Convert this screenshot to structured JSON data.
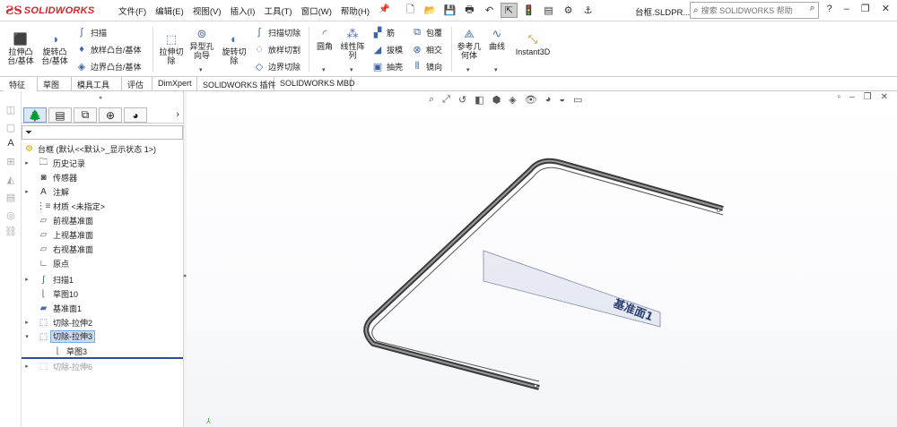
{
  "app": {
    "logo_text": "SOLIDWORKS",
    "document_title": "台框.SLDPR...",
    "search_placeholder": "搜索 SOLIDWORKS 帮助"
  },
  "menu": [
    "文件(F)",
    "编辑(E)",
    "视图(V)",
    "插入(I)",
    "工具(T)",
    "窗口(W)",
    "帮助(H)"
  ],
  "ribbon": {
    "extrude_boss": "拉伸凸\n台/基体",
    "revolve_boss": "旋转凸\n台/基体",
    "sweep": "扫描",
    "loft_boss": "放样凸台/基体",
    "boundary_boss": "边界凸台/基体",
    "extrude_cut": "拉伸切\n除",
    "hole_wizard": "异型孔\n向导",
    "revolve_cut": "旋转切\n除",
    "sweep_cut": "扫描切除",
    "loft_cut": "放样切割",
    "boundary_cut": "边界切除",
    "fillet": "圆角",
    "linear_pattern": "线性阵\n列",
    "rib": "筋",
    "draft": "拔模",
    "shell": "抽壳",
    "wrap": "包覆",
    "intersect": "相交",
    "mirror": "镜向",
    "reference_geometry": "参考几\n何体",
    "curves": "曲线",
    "instant3d": "Instant3D"
  },
  "tabs": [
    "特征",
    "草图",
    "模具工具",
    "评估",
    "DimXpert",
    "SOLIDWORKS 插件",
    "SOLIDWORKS MBD"
  ],
  "tree": {
    "root": "台框 (默认<<默认>_显示状态 1>)",
    "history": "历史记录",
    "sensors": "传感器",
    "annotations": "注解",
    "material": "材质 <未指定>",
    "front_plane": "前视基准面",
    "top_plane": "上视基准面",
    "right_plane": "右视基准面",
    "origin": "原点",
    "sweep1": "扫描1",
    "sketch10": "草图10",
    "plane1": "基准面1",
    "cut_extrude2": "切除-拉伸2",
    "cut_extrude3": "切除-拉伸3",
    "sketch3": "草图3",
    "cut_extrude6": "切除-拉伸6"
  },
  "graphics": {
    "plane_label": "基准面1"
  },
  "colors": {
    "brand": "#d4262c",
    "selection": "#c6dcf3",
    "rollback_bar": "#2b4f97",
    "plane_text": "#2a3f73"
  }
}
